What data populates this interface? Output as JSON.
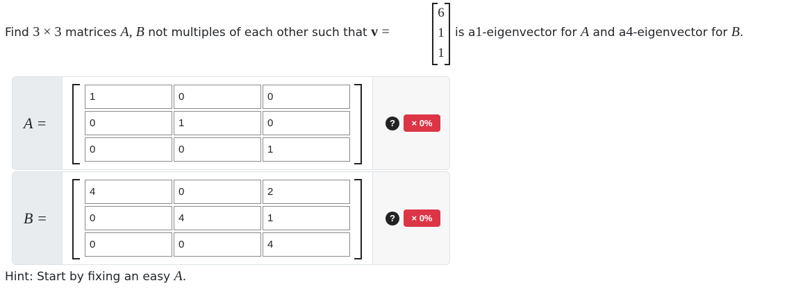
{
  "question": {
    "text_find": "Find",
    "dims": "3 × 3",
    "text_matrices": "matrices",
    "mat_names": "A, B",
    "text_mid": "not multiples of each other such that",
    "vec_symbol": "v",
    "equals": "=",
    "vector": [
      "6",
      "1",
      "1"
    ],
    "text_is": "is a",
    "eig1": "1",
    "text_eig_for": "-eigenvector for",
    "mat_a": "A",
    "text_and": "and a",
    "eig2": "4",
    "text_eig_for2": "-eigenvector for",
    "mat_b": "B",
    "period": "."
  },
  "matrix_a": {
    "label": "A =",
    "cells": [
      [
        "1",
        "0",
        "0"
      ],
      [
        "0",
        "1",
        "0"
      ],
      [
        "0",
        "0",
        "1"
      ]
    ],
    "help_icon": "question-circle-icon",
    "badge": "× 0%"
  },
  "matrix_b": {
    "label": "B =",
    "cells": [
      [
        "4",
        "0",
        "2"
      ],
      [
        "0",
        "4",
        "1"
      ],
      [
        "0",
        "0",
        "4"
      ]
    ],
    "help_icon": "question-circle-icon",
    "badge": "× 0%"
  },
  "hint": {
    "text": "Hint: Start by fixing an easy",
    "mat": "A",
    "period": "."
  },
  "colors": {
    "badge_bg": "#dc3545",
    "label_bg": "#e9ecef",
    "row_bg": "#f7f7f7"
  }
}
